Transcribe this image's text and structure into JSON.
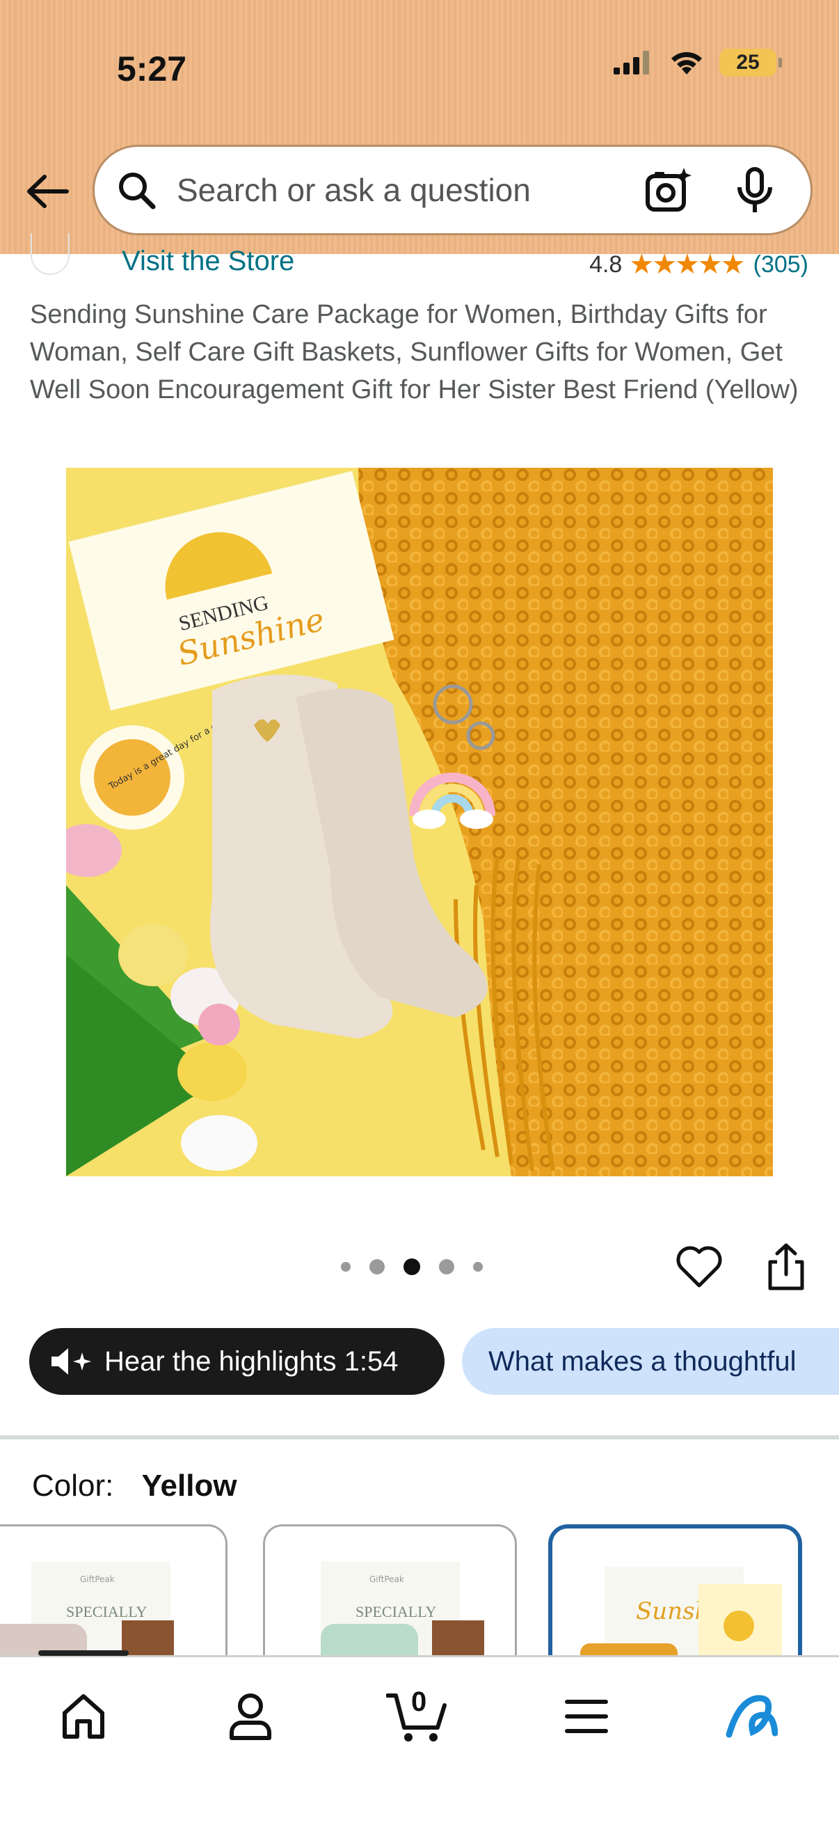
{
  "status_bar": {
    "time": "5:27",
    "battery": "25",
    "icons": [
      "signal-icon",
      "wifi-icon",
      "battery-icon"
    ]
  },
  "search": {
    "placeholder": "Search or ask a question",
    "icons": [
      "back-arrow-icon",
      "search-icon",
      "camera-icon",
      "microphone-icon"
    ]
  },
  "store": {
    "link_label": "Visit the Store",
    "rating_value": "4.8",
    "stars": "★★★★★",
    "rating_count": "(305)"
  },
  "product": {
    "title": "Sending Sunshine Care Package for Women, Birthday Gifts for Woman, Self Care Gift Baskets, Sunflower Gifts for Women, Get Well Soon Encouragement Gift for Her Sister Best Friend (Yellow)",
    "image_card_text_1": "SENDING",
    "image_card_text_2": "Sunshine",
    "image_badge_text": "Today is a great day for a great day!",
    "image_count": 5,
    "active_image": 3
  },
  "chips": {
    "hear_highlights": "Hear the highlights 1:54",
    "question": "What makes a thoughtful"
  },
  "color": {
    "label": "Color:",
    "value": "Yellow"
  },
  "swatches": [
    {
      "name": "swatch-pink",
      "text": "SPECIALLY",
      "brand": "GiftPeak"
    },
    {
      "name": "swatch-green",
      "text": "SPECIALLY",
      "brand": "GiftPeak"
    },
    {
      "name": "swatch-yellow",
      "text": "Sunshi",
      "selected": true
    }
  ],
  "bottom_nav": {
    "cart_count": "0",
    "items": [
      "home-icon",
      "account-icon",
      "cart-icon",
      "menu-icon",
      "rufus-icon"
    ]
  },
  "colors": {
    "header": "#EFB684",
    "link": "#007185",
    "star": "#f08804",
    "selected_border": "#2162a1",
    "chip_dark": "#1a1a1a",
    "chip_light": "#cfe2fb"
  }
}
